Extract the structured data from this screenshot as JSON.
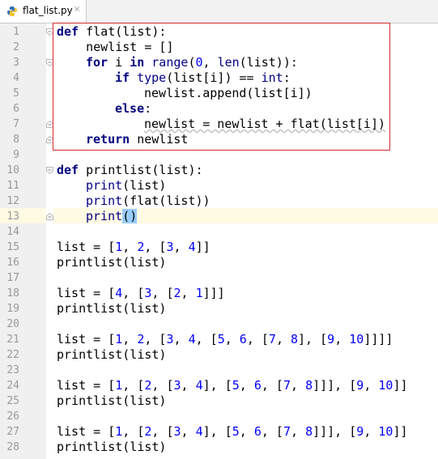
{
  "tab": {
    "filename": "flat_list.py",
    "close_glyph": "×",
    "icon": "python-file-icon"
  },
  "editor": {
    "current_line": 13,
    "lines": [
      {
        "n": "1"
      },
      {
        "n": "2"
      },
      {
        "n": "3"
      },
      {
        "n": "4"
      },
      {
        "n": "5"
      },
      {
        "n": "6"
      },
      {
        "n": "7"
      },
      {
        "n": "8"
      },
      {
        "n": "9"
      },
      {
        "n": "10"
      },
      {
        "n": "11"
      },
      {
        "n": "12"
      },
      {
        "n": "13"
      },
      {
        "n": "14"
      },
      {
        "n": "15"
      },
      {
        "n": "16"
      },
      {
        "n": "17"
      },
      {
        "n": "18"
      },
      {
        "n": "19"
      },
      {
        "n": "20"
      },
      {
        "n": "21"
      },
      {
        "n": "22"
      },
      {
        "n": "23"
      },
      {
        "n": "24"
      },
      {
        "n": "25"
      },
      {
        "n": "26"
      },
      {
        "n": "27"
      },
      {
        "n": "28"
      }
    ],
    "code": {
      "l1": {
        "kw": "def",
        "rest": " flat(list):"
      },
      "l2": {
        "text": "    newlist = []"
      },
      "l3": {
        "kw": "for",
        "a": " i ",
        "kw2": "in",
        "b": " ",
        "bi": "range",
        "c": "(",
        "num": "0",
        "d": ", ",
        "bi2": "len",
        "e": "(list)):"
      },
      "l4": {
        "kw": "if",
        "a": " ",
        "bi": "type",
        "b": "(list[i]) == ",
        "bi2": "int",
        "c": ":"
      },
      "l5": {
        "text": "newlist.append(list[i])"
      },
      "l6": {
        "kw": "else",
        "a": ":"
      },
      "l7": {
        "text": "newlist = newlist + flat(list[i])"
      },
      "l8": {
        "kw": "return",
        "a": " newlist"
      },
      "l10": {
        "kw": "def",
        "rest": " printlist(list):"
      },
      "l11": {
        "bi": "print",
        "a": "(list)"
      },
      "l12": {
        "bi": "print",
        "a": "(flat(list))"
      },
      "l13": {
        "bi": "print",
        "open": "(",
        "close": ")"
      },
      "l15": {
        "a": "list = [",
        "n1": "1",
        "b": ", ",
        "n2": "2",
        "c": ", [",
        "n3": "3",
        "d": ", ",
        "n4": "4",
        "e": "]]"
      },
      "l16": {
        "text": "printlist(list)"
      },
      "l18": {
        "a": "list = [",
        "n1": "4",
        "b": ", [",
        "n2": "3",
        "c": ", [",
        "n3": "2",
        "d": ", ",
        "n4": "1",
        "e": "]]]"
      },
      "l19": {
        "text": "printlist(list)"
      },
      "l21": {
        "a": "list = [",
        "n1": "1",
        "b": ", ",
        "n2": "2",
        "c": ", [",
        "n3": "3",
        "d": ", ",
        "n4": "4",
        "e": ", [",
        "n5": "5",
        "f": ", ",
        "n6": "6",
        "g": ", [",
        "n7": "7",
        "h": ", ",
        "n8": "8",
        "i": "], [",
        "n9": "9",
        "j": ", ",
        "n10": "10",
        "k": "]]]]"
      },
      "l22": {
        "text": "printlist(list)"
      },
      "l24": {
        "a": "list = [",
        "n1": "1",
        "b": ", [",
        "n2": "2",
        "c": ", [",
        "n3": "3",
        "d": ", ",
        "n4": "4",
        "e": "], [",
        "n5": "5",
        "f": ", ",
        "n6": "6",
        "g": ", [",
        "n7": "7",
        "h": ", ",
        "n8": "8",
        "i": "]]], [",
        "n9": "9",
        "j": ", ",
        "n10": "10",
        "k": "]]"
      },
      "l25": {
        "text": "printlist(list)"
      },
      "l27": {
        "a": "list = [",
        "n1": "1",
        "b": ", [",
        "n2": "2",
        "c": ", [",
        "n3": "3",
        "d": ", ",
        "n4": "4",
        "e": "], [",
        "n5": "5",
        "f": ", ",
        "n6": "6",
        "g": ", [",
        "n7": "7",
        "h": ", ",
        "n8": "8",
        "i": "]]], [",
        "n9": "9",
        "j": ", ",
        "n10": "10",
        "k": "]]"
      },
      "l28": {
        "text": "printlist(list)"
      }
    }
  },
  "colors": {
    "keyword": "#000080",
    "number": "#0000ff",
    "annotation_box": "#d22b2b",
    "current_line": "#fffae3",
    "gutter": "#f0f0f0"
  }
}
